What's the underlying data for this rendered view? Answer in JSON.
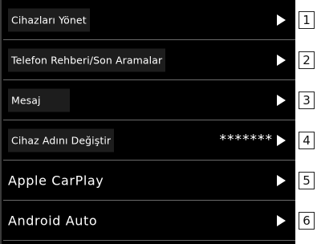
{
  "menu": {
    "items": [
      {
        "label": "Cihazları Yönet",
        "value": "",
        "number": "1"
      },
      {
        "label": "Telefon Rehberi/Son Aramalar",
        "value": "",
        "number": "2"
      },
      {
        "label": "Mesaj",
        "value": "",
        "number": "3"
      },
      {
        "label": "Cihaz Adını Değiştir",
        "value": "*******",
        "number": "4"
      },
      {
        "label": "Apple CarPlay",
        "value": "",
        "number": "5"
      },
      {
        "label": "Android Auto",
        "value": "",
        "number": "6"
      }
    ]
  },
  "icons": {
    "arrow": "chevron-right-icon"
  },
  "colors": {
    "background": "#000000",
    "text": "#ffffff",
    "label_box": "#1d1d1d",
    "divider": "#6a6a6a"
  }
}
